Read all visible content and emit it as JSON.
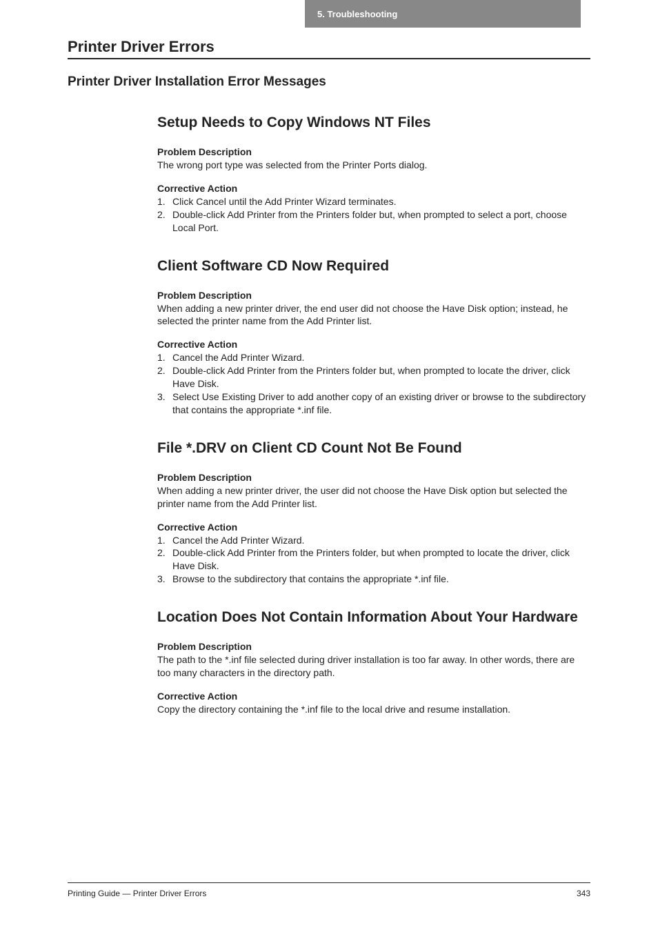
{
  "header": {
    "tab": "5.  Troubleshooting"
  },
  "chapter_title": "Printer Driver Errors",
  "section_title": "Printer Driver Installation Error Messages",
  "subsections": [
    {
      "title": "Setup Needs to Copy Windows NT Files",
      "problem_label": "Problem Description",
      "problem_desc": "The wrong port type was selected from the Printer Ports dialog.",
      "action_label": "Corrective Action",
      "actions": [
        "Click Cancel until the Add Printer Wizard terminates.",
        "Double-click Add Printer from the Printers folder but, when prompted to select a port, choose Local Port."
      ]
    },
    {
      "title": "Client Software CD Now Required",
      "problem_label": "Problem Description",
      "problem_desc": "When adding a new printer driver, the end user did not choose the Have Disk option; instead, he selected the printer name from the Add Printer list.",
      "action_label": "Corrective Action",
      "actions": [
        "Cancel the Add Printer Wizard.",
        "Double-click Add Printer from the Printers folder but, when prompted to locate the driver, click Have Disk.",
        "Select Use Existing Driver to add another copy of an existing driver or browse to the subdirectory that contains the appropriate *.inf file."
      ]
    },
    {
      "title": "File *.DRV on Client CD Count Not Be Found",
      "problem_label": "Problem Description",
      "problem_desc": "When adding a new printer driver, the user did not choose the Have Disk option but selected the printer name from the Add Printer list.",
      "action_label": "Corrective Action",
      "actions": [
        "Cancel the Add Printer Wizard.",
        "Double-click Add Printer from the Printers folder, but when prompted to locate the driver, click Have Disk.",
        "Browse to the subdirectory that contains the appropriate *.inf file."
      ]
    },
    {
      "title": "Location Does Not Contain Information About Your Hardware",
      "problem_label": "Problem Description",
      "problem_desc": "The path to the *.inf file selected during driver installation is too far away. In other words, there are too many characters in the directory path.",
      "action_label": "Corrective Action",
      "action_desc": "Copy the directory containing the *.inf file to the local drive and resume installation."
    }
  ],
  "footer": {
    "left": "Printing Guide — Printer Driver Errors",
    "right": "343"
  }
}
